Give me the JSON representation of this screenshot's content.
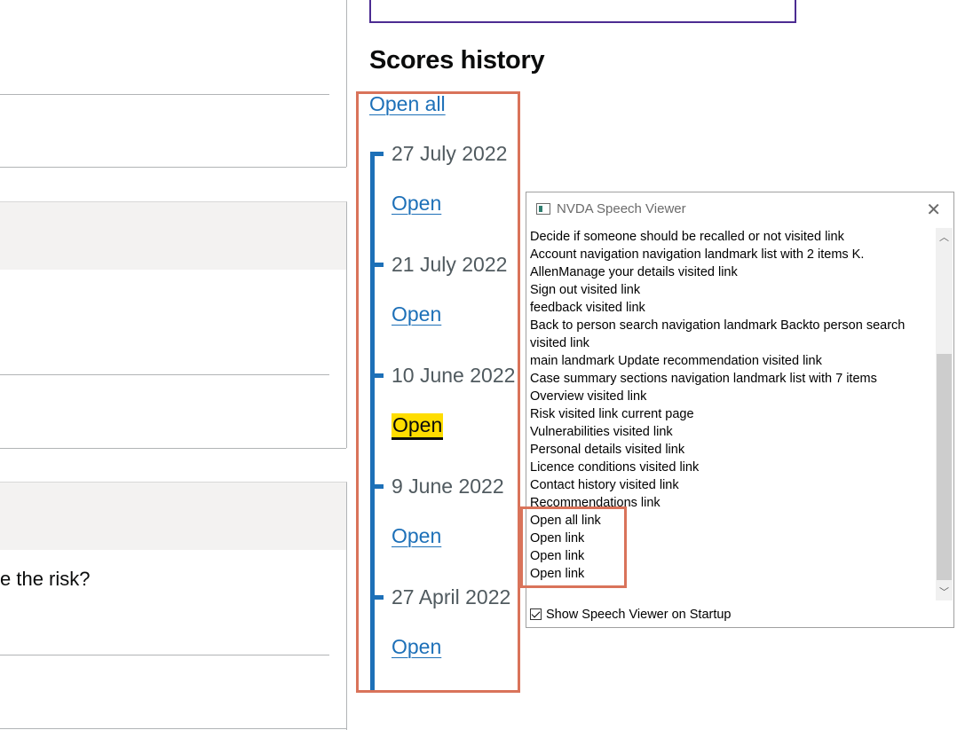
{
  "left_panel": {
    "partial_question": "e the risk?"
  },
  "scores_history": {
    "heading": "Scores history",
    "open_all_label": "Open all",
    "entries": [
      {
        "date": "27 July 2022",
        "link": "Open"
      },
      {
        "date": "21 July 2022",
        "link": "Open"
      },
      {
        "date": "10 June 2022",
        "link": "Open"
      },
      {
        "date": "9 June 2022",
        "link": "Open"
      },
      {
        "date": "27 April 2022",
        "link": "Open"
      }
    ]
  },
  "nvda": {
    "title": "NVDA Speech Viewer",
    "lines": [
      "Decide if someone should be recalled or not  visited  link",
      "Account navigation  navigation landmark    list  with 2 items  K.",
      "AllenManage your details  visited  link",
      "Sign out  visited  link",
      "feedback  visited  link",
      "Back to person search  navigation landmark    Backto person search",
      "visited  link",
      "main landmark    Update recommendation  visited  link",
      "Case summary sections  navigation landmark    list  with 7 items",
      "Overview  visited  link",
      "Risk  visited  link    current page",
      "Vulnerabilities  visited  link",
      "Personal details  visited  link",
      "Licence conditions  visited  link",
      "Contact history  visited  link",
      "Recommendations  link",
      "Open all  link",
      "Open  link",
      "Open  link",
      "Open  link"
    ],
    "show_on_startup_label": "Show Speech Viewer on Startup",
    "show_on_startup_checked": true
  },
  "colors": {
    "link": "#1d70b8",
    "focus": "#ffdd00",
    "annotation": "#d9735a"
  }
}
